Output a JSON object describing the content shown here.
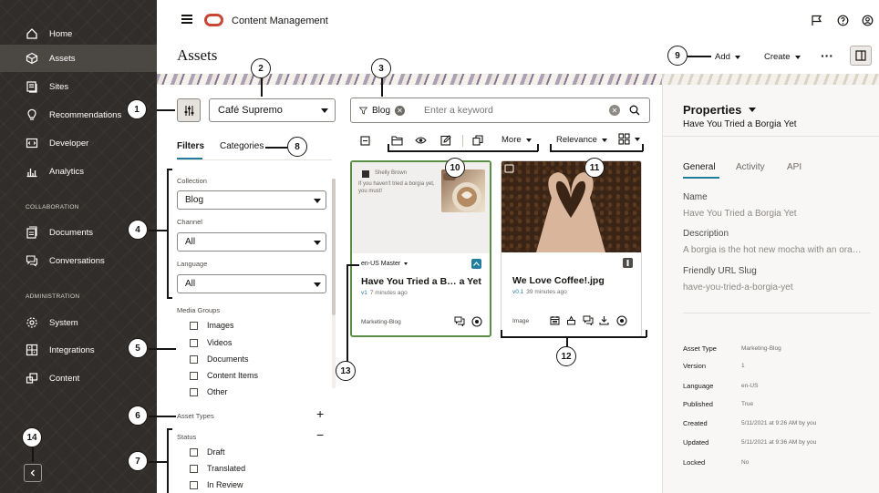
{
  "sidebar": {
    "items": [
      {
        "label": "Home",
        "icon": "home-icon"
      },
      {
        "label": "Assets",
        "icon": "assets-icon"
      },
      {
        "label": "Sites",
        "icon": "sites-icon"
      },
      {
        "label": "Recommendations",
        "icon": "recommendations-icon"
      },
      {
        "label": "Developer",
        "icon": "developer-icon"
      },
      {
        "label": "Analytics",
        "icon": "analytics-icon"
      }
    ],
    "collaboration_label": "COLLABORATION",
    "collab_items": [
      {
        "label": "Documents",
        "icon": "documents-icon"
      },
      {
        "label": "Conversations",
        "icon": "conversations-icon"
      }
    ],
    "administration_label": "ADMINISTRATION",
    "admin_items": [
      {
        "label": "System",
        "icon": "gear-icon"
      },
      {
        "label": "Integrations",
        "icon": "integrations-icon"
      },
      {
        "label": "Content",
        "icon": "content-icon"
      }
    ],
    "active": "Assets"
  },
  "header": {
    "app_title": "Content Management",
    "page_title": "Assets",
    "add_label": "Add",
    "create_label": "Create",
    "more_glyph": "···"
  },
  "filters": {
    "repository": "Café Supremo",
    "tabs": [
      "Filters",
      "Categories"
    ],
    "collection_label": "Collection",
    "collection_value": "Blog",
    "channel_label": "Channel",
    "channel_value": "All",
    "language_label": "Language",
    "language_value": "All",
    "media_groups_label": "Media Groups",
    "media_groups": [
      "Images",
      "Videos",
      "Documents",
      "Content Items",
      "Other"
    ],
    "asset_types_label": "Asset Types",
    "status_label": "Status",
    "status_items": [
      "Draft",
      "Translated",
      "In Review"
    ]
  },
  "search": {
    "chip_label": "Blog",
    "placeholder": "Enter a keyword"
  },
  "toolbar": {
    "more_label": "More",
    "sort_label": "Relevance"
  },
  "cards": [
    {
      "snippet_author": "Shelly Brown",
      "snippet_text": "If you haven't tried a borgia yet, you must!",
      "language": "en-US Master",
      "name": "Have You Tried a B… a Yet",
      "version": "v1",
      "updated": "7 minutes ago",
      "type": "Marketing-Blog",
      "badge_color": "#227e9e"
    },
    {
      "name": "We Love Coffee!.jpg",
      "version": "v0.1",
      "updated": "39 minutes ago",
      "type": "Image",
      "badge_color": "#4f4b47"
    }
  ],
  "properties": {
    "title": "Properties",
    "subtitle": "Have You Tried a Borgia Yet",
    "tabs": [
      "General",
      "Activity",
      "API"
    ],
    "name_label": "Name",
    "name_value": "Have You Tried a Borgia Yet",
    "description_label": "Description",
    "description_value": "A borgia is the hot new mocha with an ora…",
    "slug_label": "Friendly URL Slug",
    "slug_value": "have-you-tried-a-borgia-yet",
    "meta": [
      {
        "key": "Asset Type",
        "value": "Marketing-Blog"
      },
      {
        "key": "Version",
        "value": "1"
      },
      {
        "key": "Language",
        "value": "en-US"
      },
      {
        "key": "Published",
        "value": "True"
      },
      {
        "key": "Created",
        "value": "5/11/2021 at 9:26 AM by you"
      },
      {
        "key": "Updated",
        "value": "5/11/2021 at 9:36 AM by you"
      },
      {
        "key": "Locked",
        "value": "No"
      }
    ]
  },
  "callouts": [
    "1",
    "2",
    "3",
    "4",
    "5",
    "6",
    "7",
    "8",
    "9",
    "10",
    "11",
    "12",
    "13",
    "14"
  ],
  "colors": {
    "accent": "#227e9e",
    "brand": "#c74634",
    "sidebar": "#312d2a",
    "selected_border": "#5b8f45"
  }
}
